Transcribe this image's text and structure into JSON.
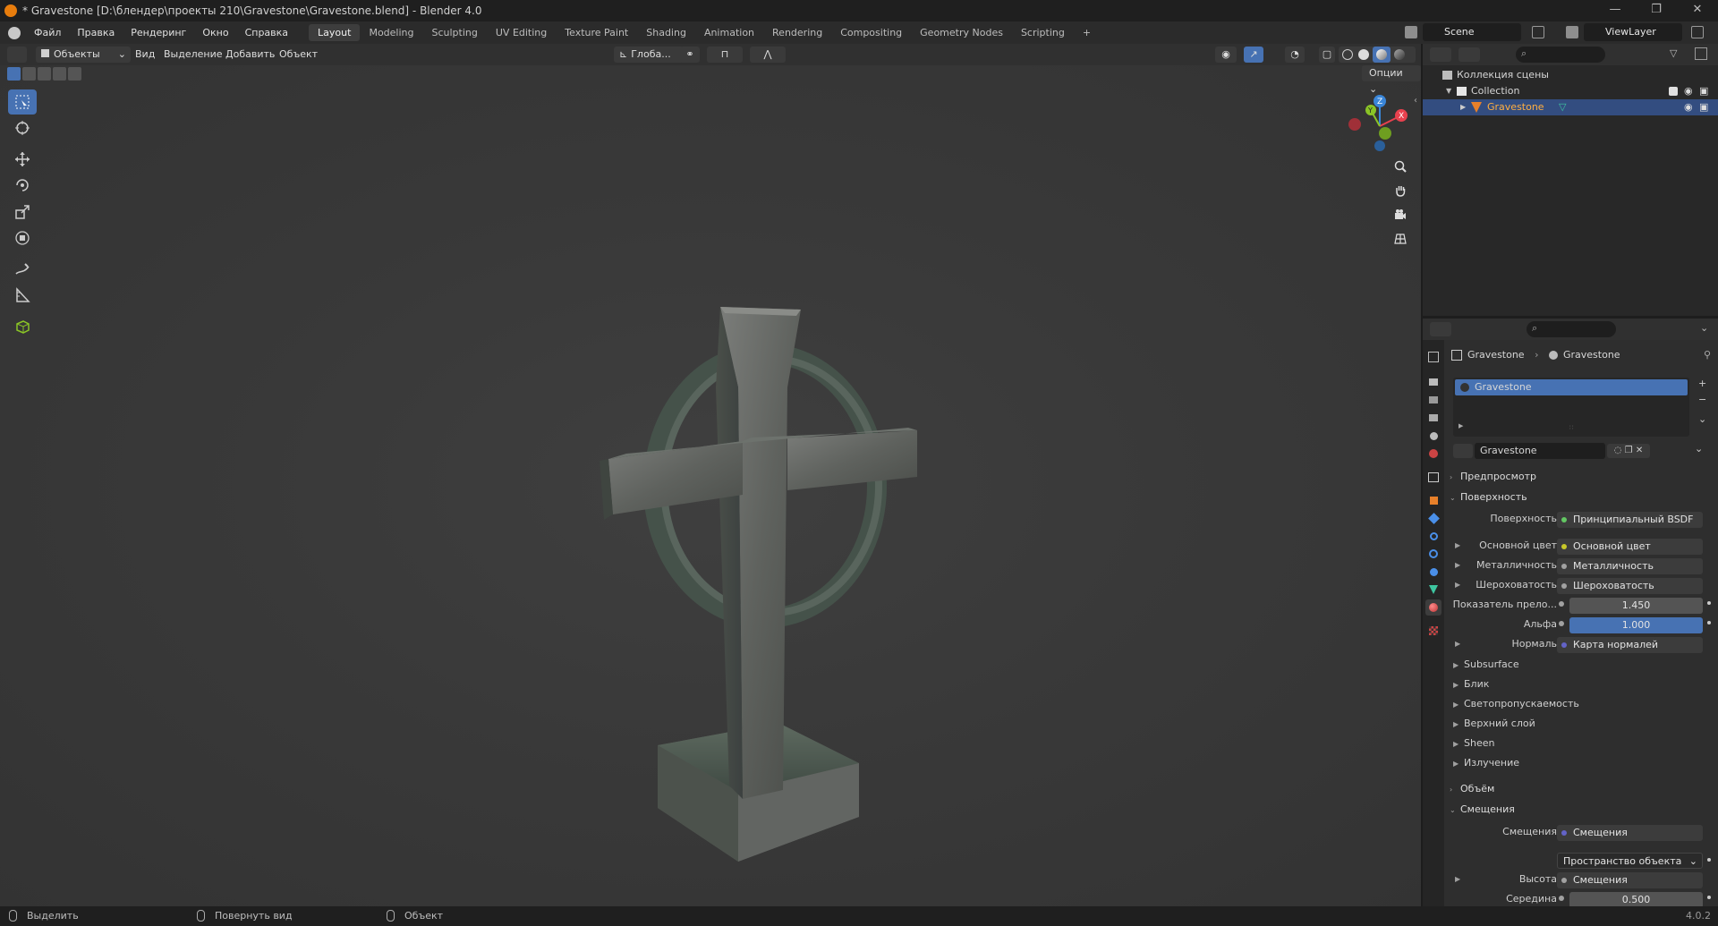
{
  "window": {
    "title": "* Gravestone [D:\\блендер\\проекты 210\\Gravestone\\Gravestone.blend] - Blender 4.0",
    "controls": [
      "—",
      "❐",
      "✕"
    ]
  },
  "menubar": {
    "menus": [
      "Файл",
      "Правка",
      "Рендеринг",
      "Окно",
      "Справка"
    ],
    "workspaces": [
      "Layout",
      "Modeling",
      "Sculpting",
      "UV Editing",
      "Texture Paint",
      "Shading",
      "Animation",
      "Rendering",
      "Compositing",
      "Geometry Nodes",
      "Scripting"
    ],
    "active_workspace": "Layout",
    "add_tab": "+",
    "scene": "Scene",
    "view_layer": "ViewLayer"
  },
  "viewport_header": {
    "mode": "Объекты",
    "menus": [
      "Вид",
      "Выделение",
      "Добавить",
      "Объект"
    ],
    "transform_orientation": "Глоба...",
    "options": "Опции"
  },
  "outliner": {
    "root": "Коллекция сцены",
    "collection": "Collection",
    "object": "Gravestone"
  },
  "properties": {
    "breadcrumb_object": "Gravestone",
    "breadcrumb_material": "Gravestone",
    "slot": "Gravestone",
    "material_name": "Gravestone",
    "sections": {
      "preview": "Предпросмотр",
      "surface": "Поверхность",
      "volume": "Объём",
      "displacement": "Смещения"
    },
    "surface_label": "Поверхность",
    "surface_value": "Принципиальный BSDF",
    "base_color_label": "Основной цвет",
    "base_color_value": "Основной цвет",
    "metallic_label": "Металличность",
    "metallic_value": "Металличность",
    "roughness_label": "Шероховатость",
    "roughness_value": "Шероховатость",
    "ior_label": "Показатель прело...",
    "ior_value": "1.450",
    "alpha_label": "Альфа",
    "alpha_value": "1.000",
    "normal_label": "Нормаль",
    "normal_value": "Карта нормалей",
    "subpanels": [
      "Subsurface",
      "Блик",
      "Светопропускаемость",
      "Верхний слой",
      "Sheen",
      "Излучение"
    ],
    "disp_label": "Смещения",
    "disp_value": "Смещения",
    "disp_space": "Пространство объекта",
    "height_label": "Высота",
    "height_value": "Смещения",
    "midlevel_label": "Середина",
    "midlevel_value": "0.500"
  },
  "statusbar": {
    "select": "Выделить",
    "rotate": "Повернуть вид",
    "object": "Объект",
    "version": "4.0.2"
  },
  "colors": {
    "accent": "#4772b3",
    "blender_orange": "#e87d0d",
    "axis_x": "#e8414e",
    "axis_y": "#8ac426",
    "axis_z": "#3a86d8"
  }
}
